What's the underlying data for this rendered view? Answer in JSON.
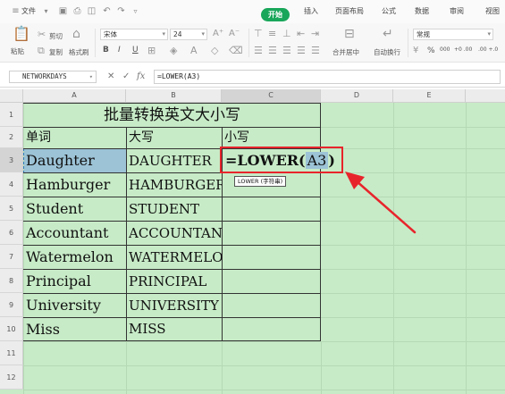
{
  "menubar": {
    "file_label": "文件",
    "tabs": [
      "开始",
      "插入",
      "页面布局",
      "公式",
      "数据",
      "审阅",
      "视图"
    ],
    "active_tab": "开始"
  },
  "ribbon": {
    "paste_label": "粘贴",
    "cut_label": "剪切",
    "copy_label": "复制",
    "format_painter_label": "格式刷",
    "font_name": "宋体",
    "font_size": "24",
    "bold": "B",
    "italic": "I",
    "underline": "U",
    "merge_center_label": "合并居中",
    "wrap_text_label": "自动换行",
    "number_format": "常规",
    "percent": "%",
    "thousands": "000",
    "inc_decimal": "+0 .00",
    "dec_decimal": ".00 +.0"
  },
  "formula_bar": {
    "name_box": "NETWORKDAYS",
    "cancel_icon": "close-icon",
    "confirm_icon": "check-icon",
    "fx_label": "fx",
    "formula": "=LOWER(A3)"
  },
  "grid": {
    "columns": [
      "A",
      "B",
      "C",
      "D",
      "E"
    ],
    "rows": [
      "1",
      "2",
      "3",
      "4",
      "5",
      "6",
      "7",
      "8",
      "9",
      "10",
      "11",
      "12"
    ],
    "title": "批量转换英文大小写",
    "headers": [
      "单词",
      "大写",
      "小写"
    ],
    "words": [
      "Daughter",
      "Hamburger",
      "Student",
      "Accountant",
      "Watermelon",
      "Principal",
      "University",
      "Miss"
    ],
    "uppercase": [
      "DAUGHTER",
      "HAMBURGER",
      "STUDENT",
      "ACCOUNTANT",
      "WATERMELON",
      "PRINCIPAL",
      "UNIVERSITY",
      "MISS"
    ],
    "editing_formula_prefix": "=LOWER(",
    "editing_formula_ref": "A3",
    "editing_formula_suffix": ")",
    "tooltip": "LOWER (字符串)"
  },
  "colors": {
    "grid_bg": "#c7ebc7",
    "selection_fill": "#9cc3d6",
    "annotation_red": "#e8242b",
    "active_tab_green": "#19a65a"
  }
}
